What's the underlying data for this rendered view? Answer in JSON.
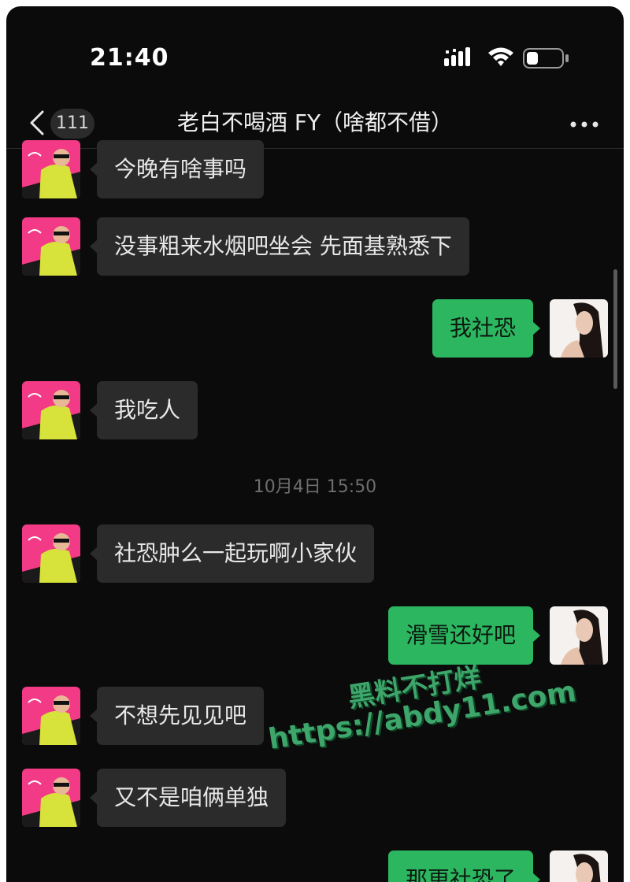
{
  "status_bar": {
    "time": "21:40",
    "icons": [
      "signal-icon",
      "wifi-icon",
      "battery-icon"
    ]
  },
  "nav": {
    "back_icon": "chevron-left-icon",
    "unread_count": "111",
    "title": "老白不喝酒 FY（啥都不借）",
    "more_icon": "more-dots-icon"
  },
  "messages": [
    {
      "side": "in",
      "text": "今晚有啥事吗"
    },
    {
      "side": "in",
      "text": "没事粗来水烟吧坐会 先面基熟悉下"
    },
    {
      "side": "out",
      "text": "我社恐"
    },
    {
      "side": "in",
      "text": "我吃人"
    },
    {
      "side": "in",
      "text": "社恐肿么一起玩啊小家伙"
    },
    {
      "side": "out",
      "text": "滑雪还好吧"
    },
    {
      "side": "in",
      "text": "不想先见见吧"
    },
    {
      "side": "in",
      "text": "又不是咱俩单独"
    },
    {
      "side": "out",
      "text": "那更社恐了"
    }
  ],
  "timestamp": "10月4日 15:50",
  "watermark": {
    "line1": "黑料不打烊",
    "line2": "https://abdy11.com"
  },
  "colors": {
    "background": "#0b0b0b",
    "bubble_in": "#2b2b2b",
    "bubble_out": "#2cb660",
    "watermark": "#3ea66a"
  }
}
